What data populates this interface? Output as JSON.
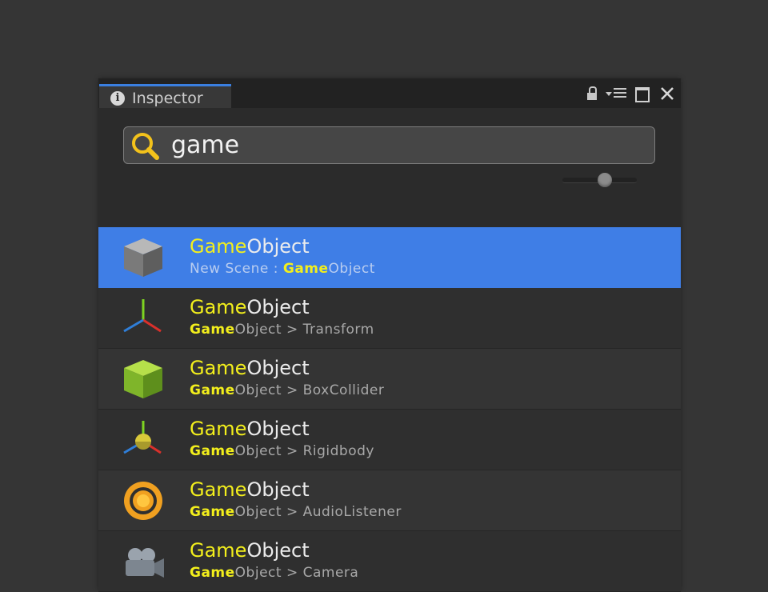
{
  "inspector": {
    "tab_label": "Inspector",
    "tab_icon": "info-icon",
    "tab_icon_glyph": "i",
    "controls": [
      "lock-icon",
      "menu-icon",
      "maximize-icon",
      "close-icon"
    ]
  },
  "search": {
    "value": "game",
    "icon": "search-icon",
    "icon_color": "#f3c21b"
  },
  "colors": {
    "accent": "#3f7ee6",
    "match_highlight": "#f3ef1c"
  },
  "results": [
    {
      "icon": "gameobject-cube-icon",
      "title_match": "Game",
      "title_rest": "Object",
      "sub_prefix": "New Scene : ",
      "sub_match": "Game",
      "sub_rest": "Object",
      "selected": true
    },
    {
      "icon": "transform-icon",
      "title_match": "Game",
      "title_rest": "Object",
      "sub_prefix": "",
      "sub_match": "Game",
      "sub_rest": "Object > Transform",
      "selected": false
    },
    {
      "icon": "box-collider-icon",
      "title_match": "Game",
      "title_rest": "Object",
      "sub_prefix": "",
      "sub_match": "Game",
      "sub_rest": "Object > BoxCollider",
      "selected": false
    },
    {
      "icon": "rigidbody-icon",
      "title_match": "Game",
      "title_rest": "Object",
      "sub_prefix": "",
      "sub_match": "Game",
      "sub_rest": "Object > Rigidbody",
      "selected": false
    },
    {
      "icon": "audio-listener-icon",
      "title_match": "Game",
      "title_rest": "Object",
      "sub_prefix": "",
      "sub_match": "Game",
      "sub_rest": "Object > AudioListener",
      "selected": false
    },
    {
      "icon": "camera-icon",
      "title_match": "Game",
      "title_rest": "Object",
      "sub_prefix": "",
      "sub_match": "Game",
      "sub_rest": "Object > Camera",
      "selected": false
    }
  ]
}
